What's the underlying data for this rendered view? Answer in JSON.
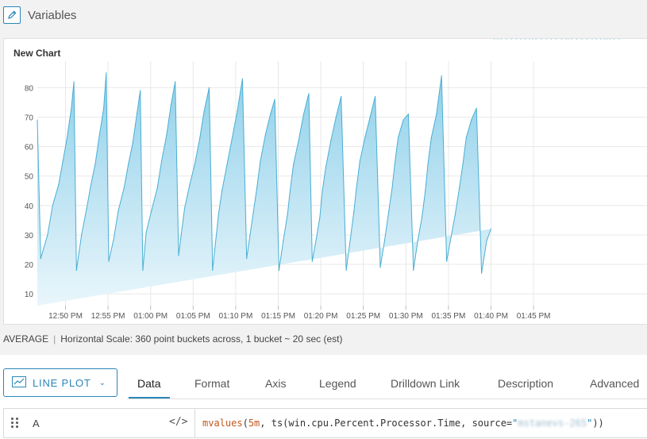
{
  "header": {
    "title": "Variables",
    "edit_icon": "pencil-icon"
  },
  "chart": {
    "title": "New Chart",
    "colors": {
      "line": "#4aaed3",
      "fill_top": "#8fd0ea",
      "fill_bottom": "#e9f6fb",
      "grid": "#e8e8e8"
    }
  },
  "chart_data": {
    "type": "area",
    "title": "New Chart",
    "xlabel": "",
    "ylabel": "",
    "ylim": [
      6,
      89
    ],
    "x_tick_labels": [
      "12:50 PM",
      "12:55 PM",
      "01:00 PM",
      "01:05 PM",
      "01:10 PM",
      "01:15 PM",
      "01:20 PM",
      "01:25 PM",
      "01:30 PM",
      "01:35 PM",
      "01:40 PM",
      "01:45 PM"
    ],
    "y_ticks": [
      10,
      20,
      30,
      40,
      50,
      60,
      70,
      80
    ],
    "grid": true,
    "legend": "none",
    "series": [
      {
        "x_minutes": [
          0,
          0.4,
          1.2,
          1.8,
          2.5,
          3.0,
          3.5,
          4.0,
          4.3,
          4.6,
          5.2,
          5.8,
          6.3,
          6.8,
          7.3,
          7.8,
          8.1,
          8.4,
          9.0,
          9.5,
          10.2,
          10.7,
          11.2,
          11.7,
          12.1,
          12.4,
          12.8,
          13.4,
          14.1,
          14.6,
          15.2,
          15.7,
          16.2,
          16.6,
          16.9,
          17.3,
          17.9,
          18.5,
          19.1,
          19.6,
          20.2,
          20.6,
          21.0,
          21.3,
          21.7,
          22.3,
          22.9,
          23.5,
          24.1,
          24.6,
          25.0,
          25.4,
          25.8,
          26.2,
          26.8,
          27.4,
          27.9,
          28.4,
          28.9,
          29.4,
          29.7,
          30.1,
          30.7,
          31.3,
          31.9,
          32.3,
          32.8,
          33.2,
          33.5,
          33.9,
          34.5,
          35.1,
          35.7,
          36.3,
          36.8,
          37.2,
          37.5,
          37.9,
          38.5,
          39.1,
          39.7,
          40.3,
          40.8,
          41.3,
          41.7,
          42.0,
          42.4,
          43.0,
          43.6,
          44.2,
          44.7,
          45.2,
          45.6,
          45.9,
          46.3,
          46.9,
          47.5,
          48.1,
          48.6,
          49.1,
          49.6,
          50.0,
          50.4,
          51.0,
          51.6,
          52.2,
          52.8,
          53.3,
          53.7,
          54.1,
          54.5,
          55.1,
          55.7,
          56.3,
          56.8,
          57.3,
          57.8,
          58.2,
          58.6,
          59.2,
          59.8,
          60.4,
          61.0,
          61.6,
          62.1,
          62.4,
          62.8,
          63.4,
          64.0,
          64.6,
          65.2,
          65.7,
          66.2,
          66.6,
          66.9,
          67.3,
          67.8,
          68.4
        ],
        "y": [
          69,
          22,
          30,
          40,
          47,
          55,
          63,
          73,
          82,
          18,
          30,
          39,
          47,
          54,
          64,
          73,
          85,
          21,
          29,
          38,
          46,
          54,
          61,
          71,
          79,
          18,
          31,
          38,
          46,
          55,
          64,
          74,
          82,
          23,
          30,
          39,
          47,
          54,
          63,
          72,
          80,
          18,
          29,
          37,
          45,
          54,
          63,
          72,
          83,
          22,
          30,
          38,
          46,
          55,
          64,
          71,
          76,
          18,
          28,
          37,
          45,
          54,
          62,
          71,
          78,
          21,
          29,
          36,
          45,
          53,
          62,
          70,
          77,
          18,
          29,
          38,
          46,
          55,
          63,
          70,
          77,
          19,
          28,
          38,
          46,
          54,
          63,
          69,
          71,
          18,
          28,
          36,
          45,
          54,
          63,
          71,
          84,
          21,
          29,
          37,
          46,
          54,
          63,
          69,
          73,
          17,
          28,
          32
        ]
      }
    ]
  },
  "status": {
    "aggregate": "AVERAGE",
    "scale_text": "Horizontal Scale: 360 point buckets across, 1 bucket ~ 20 sec (est)"
  },
  "editor": {
    "chart_type_label": "LINE PLOT",
    "chart_type_icon": "line-chart-icon",
    "tabs": [
      "Data",
      "Format",
      "Axis",
      "Legend",
      "Drilldown Link",
      "Description",
      "Advanced"
    ],
    "active_tab": "Data",
    "query": {
      "name": "A",
      "code_icon": "code-icon",
      "fn": "mvalues",
      "p1": "(",
      "arg": "5m",
      "p2": ", ts(win.cpu.Percent.Processor.Time, source=",
      "quote_open": "\"",
      "source_value": "mstanevs-265",
      "quote_close": "\"",
      "p3": "))"
    }
  }
}
